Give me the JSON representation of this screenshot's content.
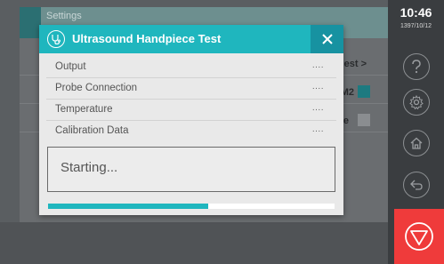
{
  "background": {
    "header_title": "Settings",
    "rows": [
      {
        "text": "est  >"
      },
      {
        "text": "M2"
      },
      {
        "text": "te"
      }
    ]
  },
  "sidebar": {
    "time": "10:46",
    "date": "1397/10/12",
    "buttons": [
      "help-icon",
      "gear-icon",
      "home-icon",
      "back-icon"
    ],
    "stop_icon": "stop-icon"
  },
  "dialog": {
    "title": "Ultrasound Handpiece Test",
    "icon": "stethoscope-icon",
    "close_icon": "close-icon",
    "tests": [
      {
        "label": "Output",
        "status": "...."
      },
      {
        "label": "Probe Connection",
        "status": "...."
      },
      {
        "label": "Temperature",
        "status": "...."
      },
      {
        "label": "Calibration Data",
        "status": "...."
      }
    ],
    "message": "Starting...",
    "progress": 0.56
  },
  "colors": {
    "accent": "#1fb6be",
    "accent_dark": "#1792a1",
    "stop": "#ef3b3b"
  }
}
